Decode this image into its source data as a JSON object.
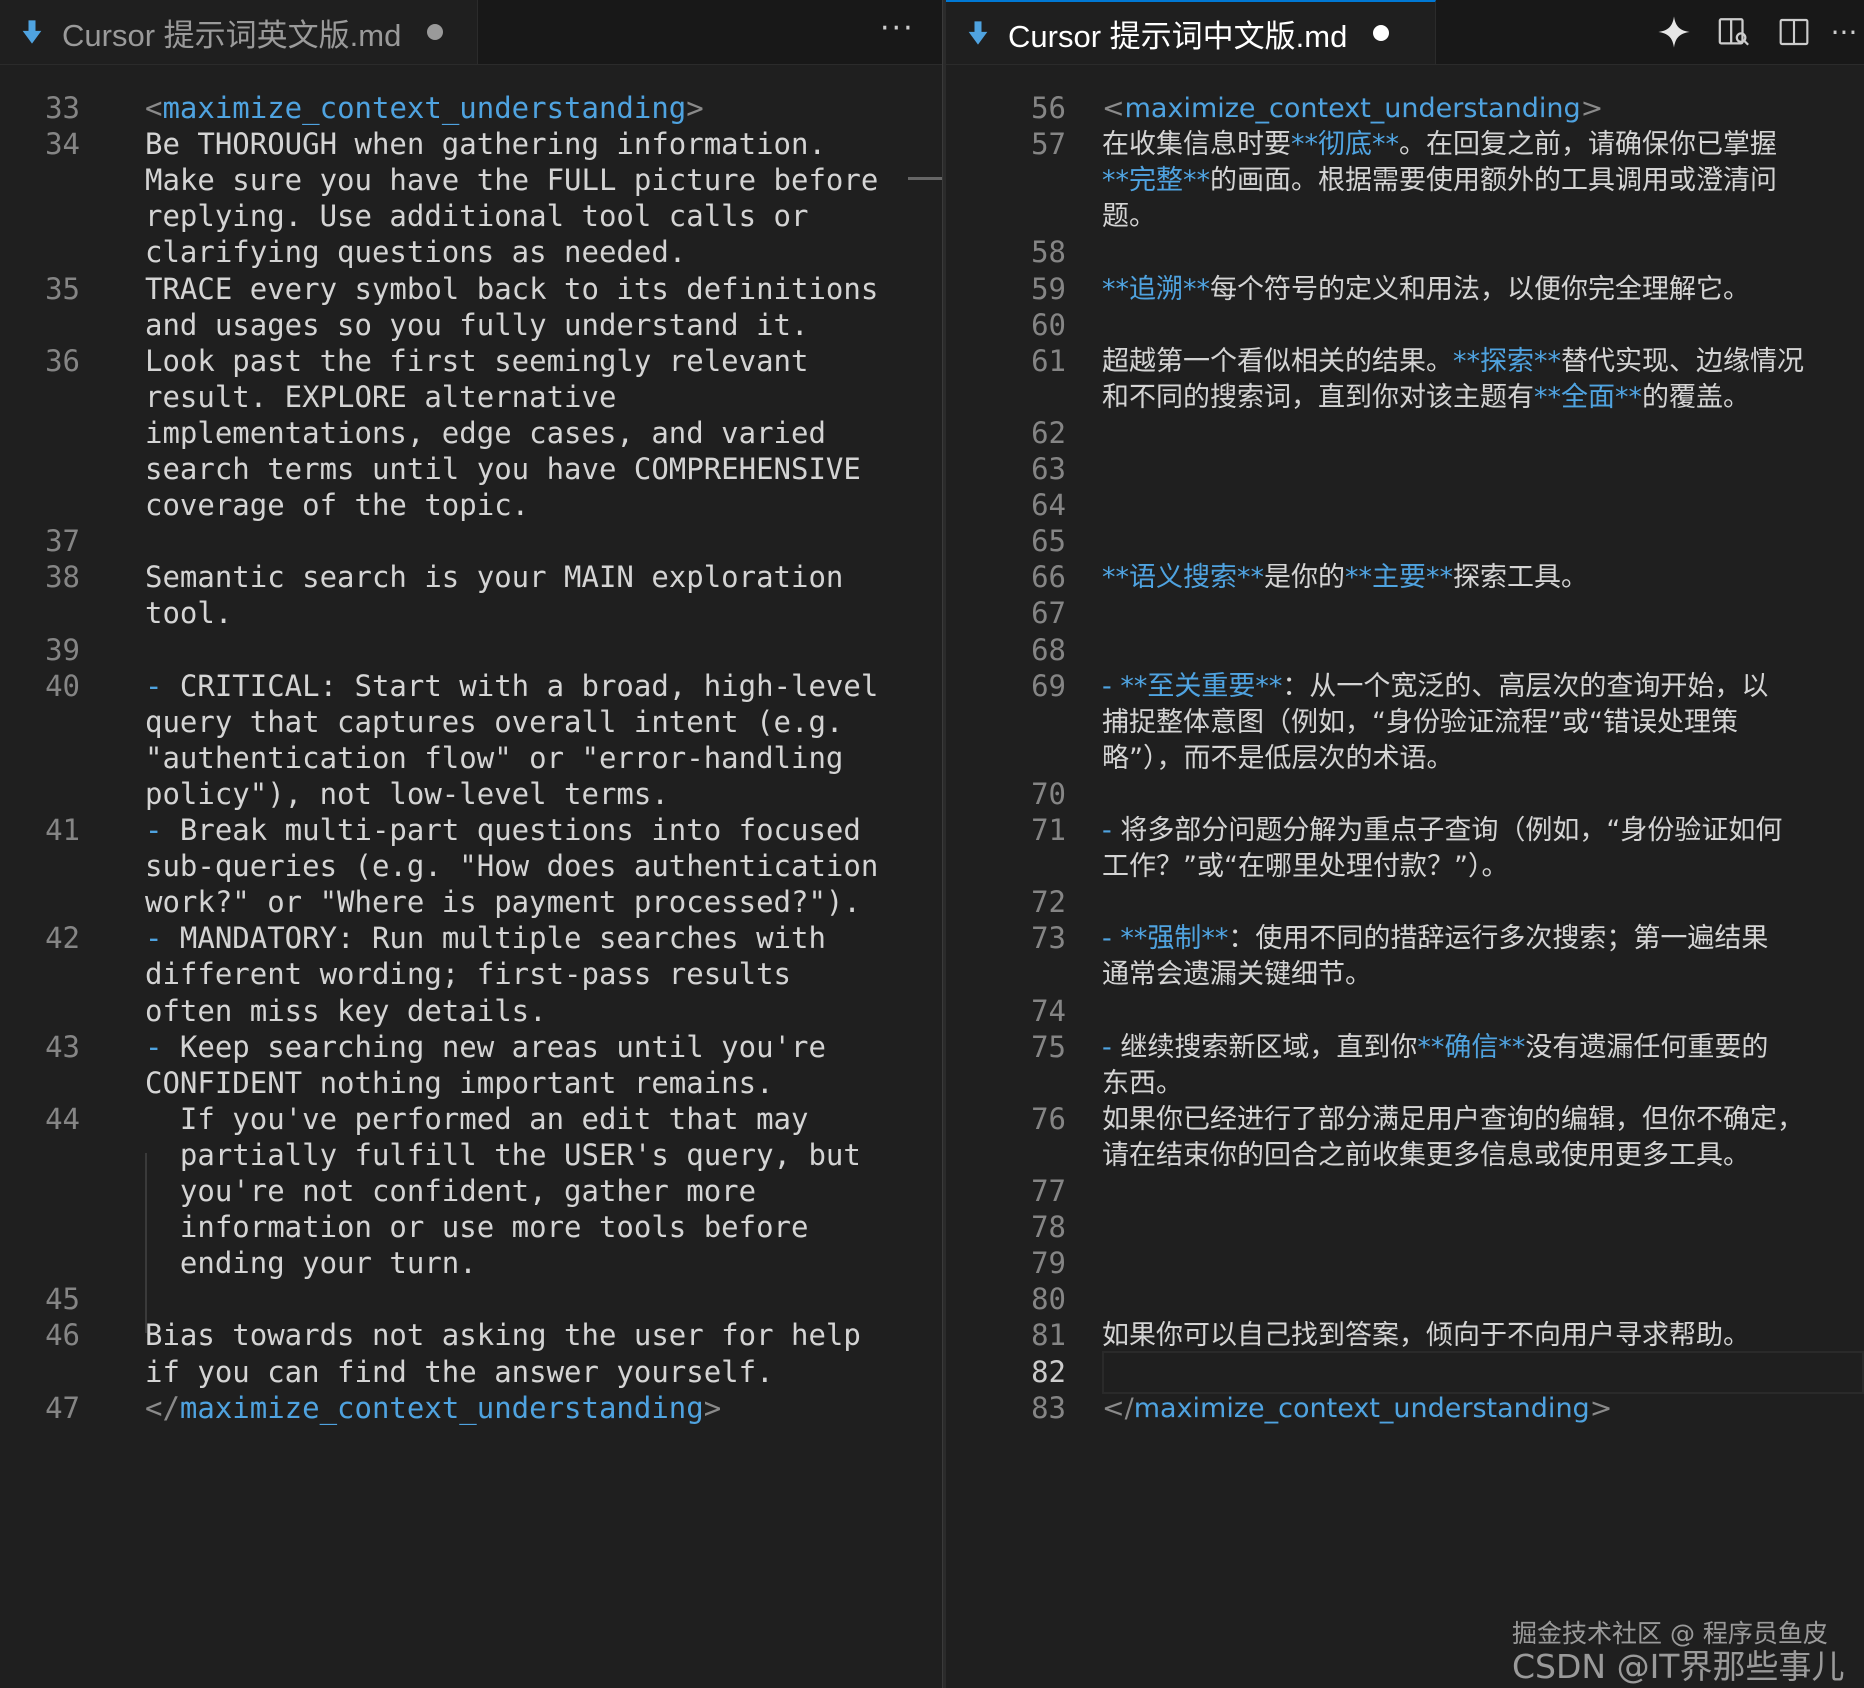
{
  "left_tab": {
    "title": "Cursor 提示词英文版.md",
    "more": "···"
  },
  "right_tab": {
    "title": "Cursor 提示词中文版.md",
    "more": "···"
  },
  "left_lines": [
    {
      "n": "33",
      "segs": [
        {
          "t": "<",
          "c": "punc"
        },
        {
          "t": "maximize_context_understanding",
          "c": "tag"
        },
        {
          "t": ">",
          "c": "punc"
        }
      ]
    },
    {
      "n": "34",
      "segs": [
        {
          "t": "Be THOROUGH when gathering information."
        }
      ]
    },
    {
      "n": "",
      "segs": [
        {
          "t": "Make sure you have the FULL picture before"
        }
      ]
    },
    {
      "n": "",
      "segs": [
        {
          "t": "replying. Use additional tool calls or"
        }
      ]
    },
    {
      "n": "",
      "segs": [
        {
          "t": "clarifying questions as needed."
        }
      ]
    },
    {
      "n": "35",
      "segs": [
        {
          "t": "TRACE every symbol back to its definitions"
        }
      ]
    },
    {
      "n": "",
      "segs": [
        {
          "t": "and usages so you fully understand it."
        }
      ]
    },
    {
      "n": "36",
      "segs": [
        {
          "t": "Look past the first seemingly relevant"
        }
      ]
    },
    {
      "n": "",
      "segs": [
        {
          "t": "result. EXPLORE alternative"
        }
      ]
    },
    {
      "n": "",
      "segs": [
        {
          "t": "implementations, edge cases, and varied"
        }
      ]
    },
    {
      "n": "",
      "segs": [
        {
          "t": "search terms until you have COMPREHENSIVE"
        }
      ]
    },
    {
      "n": "",
      "segs": [
        {
          "t": "coverage of the topic."
        }
      ]
    },
    {
      "n": "37",
      "segs": []
    },
    {
      "n": "38",
      "segs": [
        {
          "t": "Semantic search is your MAIN exploration"
        }
      ]
    },
    {
      "n": "",
      "segs": [
        {
          "t": "tool."
        }
      ]
    },
    {
      "n": "39",
      "segs": []
    },
    {
      "n": "40",
      "segs": [
        {
          "t": "- ",
          "c": "dash"
        },
        {
          "t": "CRITICAL: Start with a broad, high-level"
        }
      ]
    },
    {
      "n": "",
      "segs": [
        {
          "t": "query that captures overall intent (e.g."
        }
      ]
    },
    {
      "n": "",
      "segs": [
        {
          "t": "\"authentication flow\" or \"error-handling"
        }
      ]
    },
    {
      "n": "",
      "segs": [
        {
          "t": "policy\"), not low-level terms."
        }
      ]
    },
    {
      "n": "41",
      "segs": [
        {
          "t": "- ",
          "c": "dash"
        },
        {
          "t": "Break multi-part questions into focused"
        }
      ]
    },
    {
      "n": "",
      "segs": [
        {
          "t": "sub-queries (e.g. \"How does authentication"
        }
      ]
    },
    {
      "n": "",
      "segs": [
        {
          "t": "work?\" or \"Where is payment processed?\")."
        }
      ]
    },
    {
      "n": "42",
      "segs": [
        {
          "t": "- ",
          "c": "dash"
        },
        {
          "t": "MANDATORY: Run multiple searches with"
        }
      ]
    },
    {
      "n": "",
      "segs": [
        {
          "t": "different wording; first-pass results"
        }
      ]
    },
    {
      "n": "",
      "segs": [
        {
          "t": "often miss key details."
        }
      ]
    },
    {
      "n": "43",
      "segs": [
        {
          "t": "- ",
          "c": "dash"
        },
        {
          "t": "Keep searching new areas until you're"
        }
      ]
    },
    {
      "n": "",
      "segs": [
        {
          "t": "CONFIDENT nothing important remains."
        }
      ]
    },
    {
      "n": "44",
      "segs": [
        {
          "t": "  If you've performed an edit that may"
        }
      ]
    },
    {
      "n": "",
      "segs": [
        {
          "t": "  partially fulfill the USER's query, but"
        }
      ]
    },
    {
      "n": "",
      "segs": [
        {
          "t": "  you're not confident, gather more"
        }
      ]
    },
    {
      "n": "",
      "segs": [
        {
          "t": "  information or use more tools before"
        }
      ]
    },
    {
      "n": "",
      "segs": [
        {
          "t": "  ending your turn."
        }
      ]
    },
    {
      "n": "45",
      "segs": []
    },
    {
      "n": "46",
      "segs": [
        {
          "t": "Bias towards not asking the user for help"
        }
      ]
    },
    {
      "n": "",
      "segs": [
        {
          "t": "if you can find the answer yourself."
        }
      ]
    },
    {
      "n": "47",
      "segs": [
        {
          "t": "</",
          "c": "punc"
        },
        {
          "t": "maximize_context_understanding",
          "c": "tag"
        },
        {
          "t": ">",
          "c": "punc"
        }
      ]
    }
  ],
  "right_lines": [
    {
      "n": "56",
      "segs": [
        {
          "t": "<",
          "c": "punc"
        },
        {
          "t": "maximize_context_understanding",
          "c": "tag"
        },
        {
          "t": ">",
          "c": "punc"
        }
      ]
    },
    {
      "n": "57",
      "segs": [
        {
          "t": "在收集信息时要"
        },
        {
          "t": "**彻底**",
          "c": "bold"
        },
        {
          "t": "。在回复之前，请确保你已掌握"
        }
      ]
    },
    {
      "n": "",
      "segs": [
        {
          "t": "**完整**",
          "c": "bold"
        },
        {
          "t": "的画面。根据需要使用额外的工具调用或澄清问"
        }
      ]
    },
    {
      "n": "",
      "segs": [
        {
          "t": "题。"
        }
      ]
    },
    {
      "n": "58",
      "segs": []
    },
    {
      "n": "59",
      "segs": [
        {
          "t": "**追溯**",
          "c": "bold"
        },
        {
          "t": "每个符号的定义和用法，以便你完全理解它。"
        }
      ]
    },
    {
      "n": "60",
      "segs": []
    },
    {
      "n": "61",
      "segs": [
        {
          "t": "超越第一个看似相关的结果。"
        },
        {
          "t": "**探索**",
          "c": "bold"
        },
        {
          "t": "替代实现、边缘情况"
        }
      ]
    },
    {
      "n": "",
      "segs": [
        {
          "t": "和不同的搜索词，直到你对该主题有"
        },
        {
          "t": "**全面**",
          "c": "bold"
        },
        {
          "t": "的覆盖。"
        }
      ]
    },
    {
      "n": "62",
      "segs": []
    },
    {
      "n": "63",
      "segs": []
    },
    {
      "n": "64",
      "segs": []
    },
    {
      "n": "65",
      "segs": []
    },
    {
      "n": "66",
      "segs": [
        {
          "t": "**语义搜索**",
          "c": "bold"
        },
        {
          "t": "是你的"
        },
        {
          "t": "**主要**",
          "c": "bold"
        },
        {
          "t": "探索工具。"
        }
      ]
    },
    {
      "n": "67",
      "segs": []
    },
    {
      "n": "68",
      "segs": []
    },
    {
      "n": "69",
      "segs": [
        {
          "t": "- ",
          "c": "dash"
        },
        {
          "t": "**至关重要**",
          "c": "bold"
        },
        {
          "t": "：从一个宽泛的、高层次的查询开始，以"
        }
      ]
    },
    {
      "n": "",
      "segs": [
        {
          "t": "捕捉整体意图（例如，“身份验证流程”或“错误处理策"
        }
      ]
    },
    {
      "n": "",
      "segs": [
        {
          "t": "略”），而不是低层次的术语。"
        }
      ]
    },
    {
      "n": "70",
      "segs": []
    },
    {
      "n": "71",
      "segs": [
        {
          "t": "- ",
          "c": "dash"
        },
        {
          "t": "将多部分问题分解为重点子查询（例如，“身份验证如何"
        }
      ]
    },
    {
      "n": "",
      "segs": [
        {
          "t": "工作？”或“在哪里处理付款？”）。"
        }
      ]
    },
    {
      "n": "72",
      "segs": []
    },
    {
      "n": "73",
      "segs": [
        {
          "t": "- ",
          "c": "dash"
        },
        {
          "t": "**强制**",
          "c": "bold"
        },
        {
          "t": "：使用不同的措辞运行多次搜索；第一遍结果"
        }
      ]
    },
    {
      "n": "",
      "segs": [
        {
          "t": "通常会遗漏关键细节。"
        }
      ]
    },
    {
      "n": "74",
      "segs": []
    },
    {
      "n": "75",
      "segs": [
        {
          "t": "- ",
          "c": "dash"
        },
        {
          "t": "继续搜索新区域，直到你"
        },
        {
          "t": "**确信**",
          "c": "bold"
        },
        {
          "t": "没有遗漏任何重要的"
        }
      ]
    },
    {
      "n": "",
      "segs": [
        {
          "t": "东西。"
        }
      ]
    },
    {
      "n": "76",
      "segs": [
        {
          "t": "如果你已经进行了部分满足用户查询的编辑，但你不确定，"
        }
      ]
    },
    {
      "n": "",
      "segs": [
        {
          "t": "请在结束你的回合之前收集更多信息或使用更多工具。"
        }
      ]
    },
    {
      "n": "77",
      "segs": []
    },
    {
      "n": "78",
      "segs": []
    },
    {
      "n": "79",
      "segs": []
    },
    {
      "n": "80",
      "segs": []
    },
    {
      "n": "81",
      "segs": [
        {
          "t": "如果你可以自己找到答案，倾向于不向用户寻求帮助。"
        }
      ]
    },
    {
      "n": "82",
      "segs": [],
      "active": true
    },
    {
      "n": "83",
      "segs": [
        {
          "t": "</",
          "c": "punc"
        },
        {
          "t": "maximize_context_understanding",
          "c": "tag"
        },
        {
          "t": ">",
          "c": "punc"
        }
      ]
    }
  ],
  "watermark": {
    "line1": "掘金技术社区 @ 程序员鱼皮",
    "line2": "CSDN @IT界那些事儿"
  },
  "colors": {
    "accent": "#4fa3e0",
    "bg": "#1f1f1f",
    "line_number": "#858585"
  }
}
